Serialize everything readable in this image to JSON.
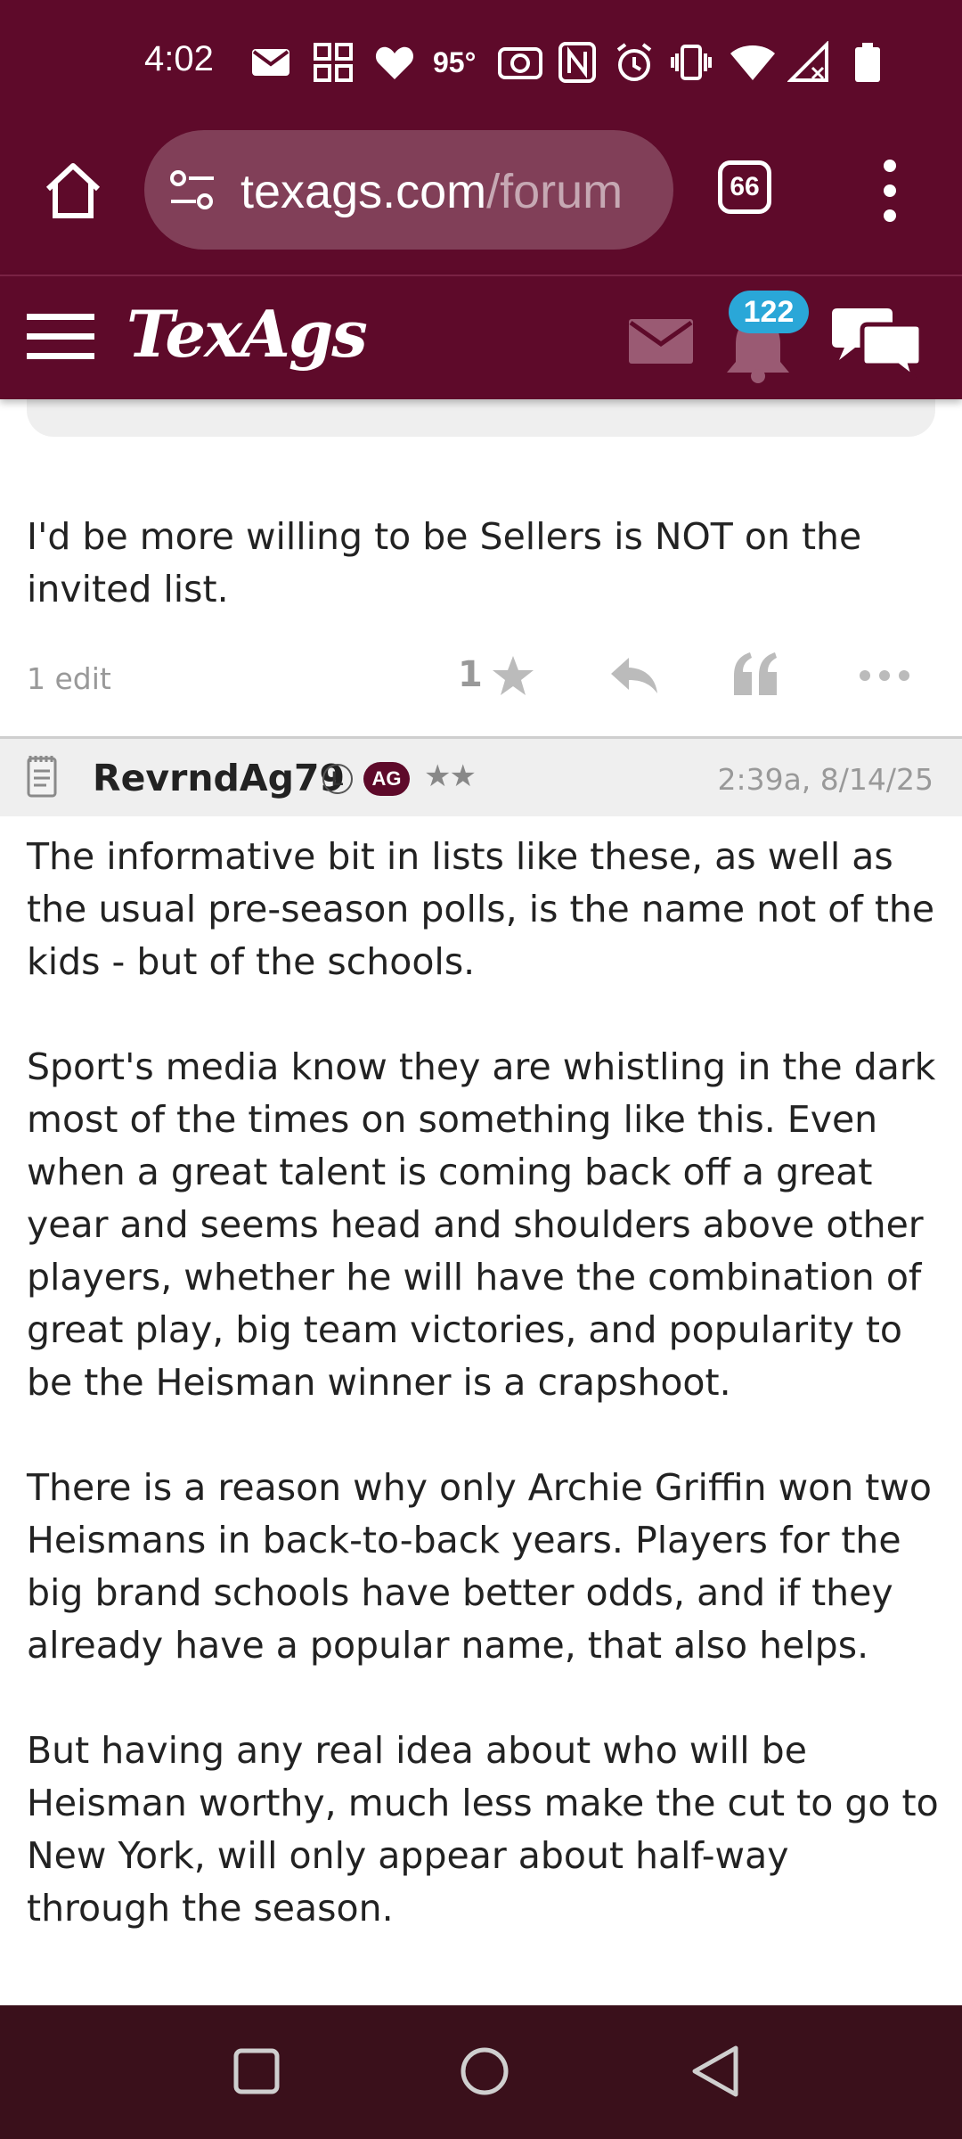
{
  "status_bar": {
    "time": "4:02",
    "temperature": "95°",
    "icons": [
      "mail-icon",
      "qr-grid-icon",
      "heart-icon",
      "camera-icon",
      "nfc-icon",
      "alarm-icon",
      "vibrate-icon",
      "wifi-icon",
      "signal-icon",
      "battery-icon"
    ]
  },
  "browser": {
    "url_host": "texags.com",
    "url_path": "/forum",
    "tab_count": "66",
    "colors": {
      "bar": "#5e0a2a"
    }
  },
  "site_header": {
    "logo": "TexAgs",
    "notification_count": "122",
    "colors": {
      "badge": "#2aa7d8"
    }
  },
  "post1": {
    "body": "I'd be more willing to be Sellers is NOT on the\ninvited list.",
    "edits": "1 edit",
    "star_count": "1"
  },
  "post2": {
    "username": "RevrndAg79",
    "badge_l": "L",
    "badge_ag": "AG",
    "rank_stars": "★★",
    "timestamp": "2:39a, 8/14/25",
    "body": "The informative bit in lists like these, as well as\nthe usual pre-season polls, is the name not of the\nkids - but of the schools.\n\nSport's media know they are whistling in the dark\nmost of the times on something like this. Even\nwhen a great talent is coming back off a great\nyear and seems head and shoulders above other\nplayers, whether he will have the combination of\ngreat play, big team victories, and popularity to\nbe the Heisman winner is a crapshoot.\n\nThere is a reason why only Archie Griffin won two\nHeismans in back-to-back years. Players for the\nbig brand schools have better odds, and if they\nalready have a popular name, that also helps.\n\nBut having any real idea about who will be\nHeisman worthy, much less make the cut to go to\nNew York, will only appear about half-way\nthrough the season."
  }
}
